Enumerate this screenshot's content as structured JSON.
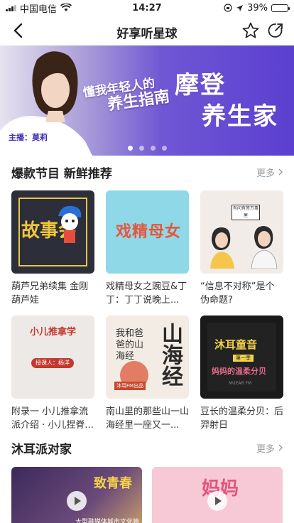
{
  "status": {
    "carrier": "中国电信",
    "time": "14:27",
    "battery": "39%",
    "battery_level": 0.39
  },
  "nav": {
    "title": "好享听星球"
  },
  "banner": {
    "subtitle_line1": "懂我年轻人的",
    "subtitle_line2": "养生指南",
    "title_line1": "摩登",
    "title_line2": "养生家",
    "host": "主播：莫莉",
    "slide_count": 4,
    "active_slide": 1
  },
  "section1": {
    "title": "爆款节目 新鲜推荐",
    "more": "更多",
    "items": [
      {
        "caption": "葫芦兄弟续集 金刚葫芦娃",
        "cover_text": "故事会",
        "cover_sub": ""
      },
      {
        "caption": "戏精母女之豌豆&丁丁：丁丁说晚上...",
        "cover_text": "戏精母女",
        "cover_sub": ""
      },
      {
        "caption": "“信息不对称”是个伪命题?",
        "cover_text": "有问有答万事屋",
        "cover_sub": "MUEAR FM"
      },
      {
        "caption": "附录一 小儿推拿流派介绍 · 小儿捏脊...",
        "cover_text": "小儿推拿学",
        "cover_sub": "授课人：杨洋"
      },
      {
        "caption": "南山里的那些山一山海经里一座又一...",
        "cover_text": "我和爸爸的山海经",
        "cover_sub": "山海经"
      },
      {
        "caption": "豆长的温柔分贝：后羿射日",
        "cover_text": "沐耳童音",
        "cover_sub": "妈妈的温柔分贝"
      }
    ],
    "c6_badge": "第一季",
    "c6_brand": "MUEAR FM",
    "c5_tag": "沐耳FM出品"
  },
  "section2": {
    "title": "沐耳派对家",
    "more": "更多",
    "items": [
      {
        "cover_text": "致青春",
        "cover_sub": "大型融媒体城市文化篇章"
      },
      {
        "cover_text": "妈妈"
      }
    ]
  }
}
